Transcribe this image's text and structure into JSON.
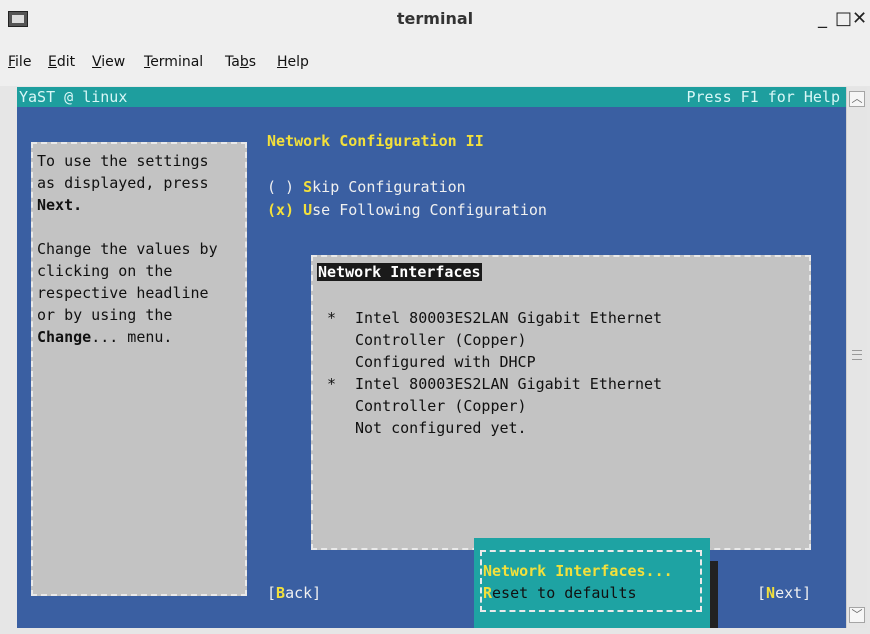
{
  "window": {
    "title": "terminal",
    "controls": {
      "minimize": "_",
      "maximize": "□",
      "close": "✕"
    }
  },
  "menubar": {
    "items": [
      "File",
      "Edit",
      "View",
      "Terminal",
      "Tabs",
      "Help"
    ]
  },
  "yast": {
    "header_left": "YaST @ linux",
    "header_right": "Press F1 for Help",
    "help_lines": [
      "To use the settings",
      "as displayed, press",
      "Next.",
      "",
      "Change the values by",
      "clicking on the",
      "respective headline",
      "or by using the",
      "Change... menu."
    ],
    "title": "Network Configuration II",
    "radio_skip": {
      "mark": "( )",
      "hot": "S",
      "rest": "kip Configuration"
    },
    "radio_use": {
      "mark": "(x)",
      "hot": "U",
      "rest": "se Following Configuration"
    },
    "list_title": "Network Interfaces",
    "interfaces": [
      {
        "bullet": "*",
        "line1": "Intel 80003ES2LAN Gigabit Ethernet",
        "line2": "Controller (Copper)",
        "line3": "Configured with DHCP"
      },
      {
        "bullet": "*",
        "line1": "Intel 80003ES2LAN Gigabit Ethernet",
        "line2": "Controller (Copper)",
        "line3": "Not configured yet."
      }
    ],
    "back": {
      "open": "[",
      "hot": "B",
      "rest": "ack]"
    },
    "next": {
      "open": "[",
      "hot": "N",
      "rest": "ext]"
    },
    "popup": {
      "item1": "Network Interfaces...",
      "item2_hot": "R",
      "item2_rest": "eset to defaults"
    }
  },
  "colors": {
    "term_bg": "#3a5fa2",
    "header_bg": "#1e9e9e",
    "hotkey": "#f3e03b",
    "panel_bg": "#c3c3c3"
  }
}
